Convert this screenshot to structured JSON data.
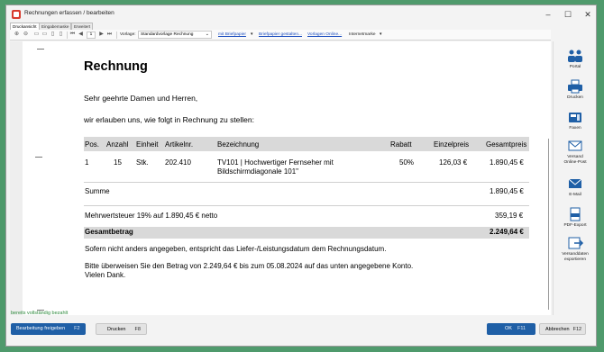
{
  "window": {
    "title": "Rechnungen erfassen / bearbeiten"
  },
  "tabs": [
    "Druckansicht",
    "Eingabemaske",
    "Erweitert"
  ],
  "toolbar": {
    "page": "1",
    "template_label": "Vorlage:",
    "template_value": "Standardvorlage Rechnung",
    "letterhead": "mit Briefpapier",
    "letterhead_link": "Briefpapier gestalten...",
    "templates_link": "Vorlagen Online...",
    "stamp": "Internetmarke"
  },
  "document": {
    "title": "Rechnung",
    "salutation": "Sehr geehrte Damen und Herren,",
    "intro": "wir erlauben uns, wie folgt in Rechnung zu stellen:",
    "columns": [
      "Pos.",
      "Anzahl",
      "Einheit",
      "Artikelnr.",
      "Bezeichnung",
      "Rabatt",
      "Einzelpreis",
      "Gesamtpreis"
    ],
    "row": {
      "pos": "1",
      "qty": "15",
      "unit": "Stk.",
      "article": "202.410",
      "desc_line1": "TV101 | Hochwertiger Fernseher mit",
      "desc_line2": "Bildschirmdiagonale 101\"",
      "discount": "50%",
      "unit_price": "126,03 €",
      "total": "1.890,45 €"
    },
    "sum_label": "Summe",
    "sum_value": "1.890,45 €",
    "vat_label": "Mehrwertsteuer 19% auf 1.890,45 € netto",
    "vat_value": "359,19 €",
    "grand_label": "Gesamtbetrag",
    "grand_value": "2.249,64 €",
    "note1": "Sofern nicht anders angegeben, entspricht das Liefer-/Leistungsdatum dem Rechnungsdatum.",
    "note2": "Bitte überweisen Sie den Betrag von 2.249,64 € bis zum 05.08.2024 auf das unten angegebene Konto.",
    "note3": "Vielen Dank."
  },
  "side_panel": {
    "portal": "Portal",
    "print": "Drucken",
    "fax": "Faxen",
    "post_1": "Versand",
    "post_2": "Online-Post",
    "email": "E-Mail",
    "pdf": "PDF-Export",
    "export_1": "Versanddaten",
    "export_2": "exportieren"
  },
  "status": "bereits vollständig bezahlt",
  "buttons": {
    "release": "Bearbeitung freigeben",
    "release_key": "F2",
    "print": "Drucken",
    "print_key": "F8",
    "ok": "OK",
    "ok_key": "F11",
    "cancel": "Abbrechen",
    "cancel_key": "F12"
  },
  "colors": {
    "accent": "#1f5fa6",
    "status": "#2e8b3d",
    "background": "#4f9a6c"
  }
}
